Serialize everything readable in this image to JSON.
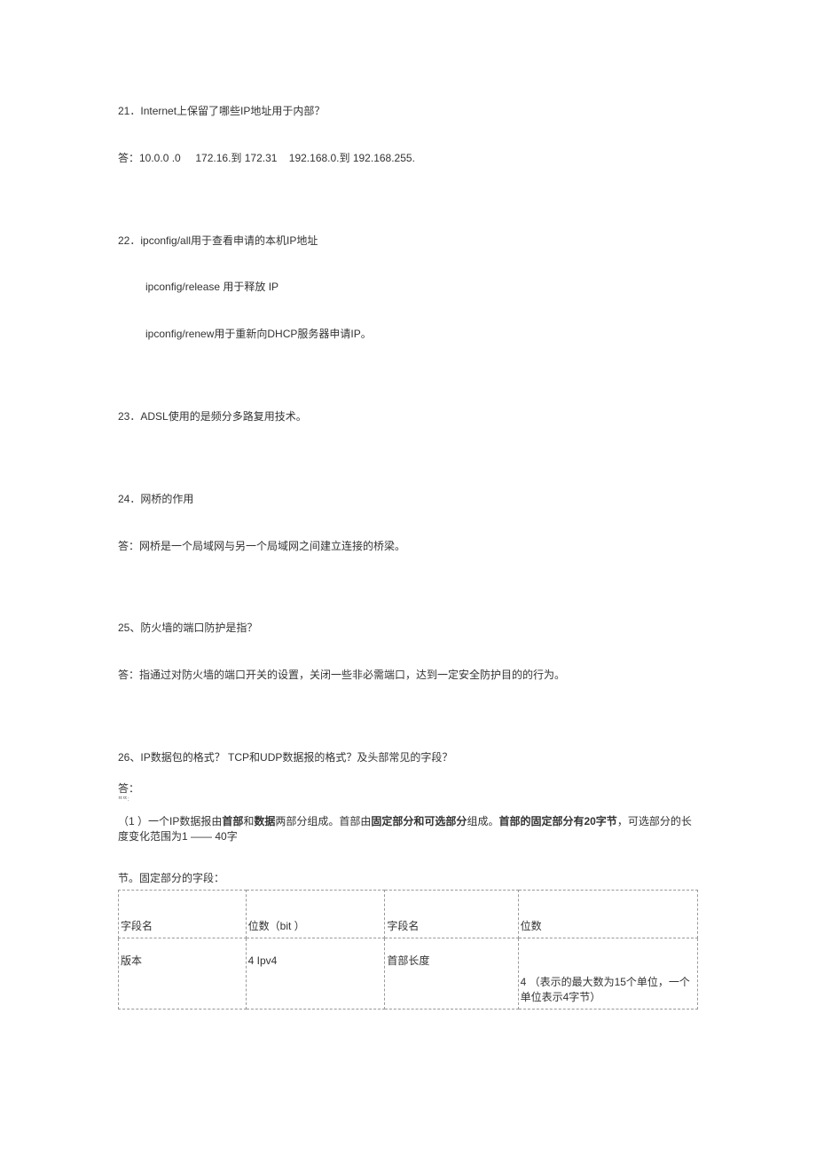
{
  "q21": {
    "num": "21．",
    "text": "Internet上保留了哪些IP地址用于内部？",
    "answer": "答：10.0.0 .0     172.16.到 172.31    192.168.0.到 192.168.255."
  },
  "q22": {
    "num": "22．",
    "line1": "ipconfig/all用于查看申请的本机IP地址",
    "line2": "ipconfig/release 用于释放 IP",
    "line3": "ipconfig/renew用于重新向DHCP服务器申请IP。"
  },
  "q23": {
    "num": "23．",
    "text": "ADSL使用的是频分多路复用技术。"
  },
  "q24": {
    "num": "24．",
    "text": "网桥的作用",
    "answer": "答：网桥是一个局域网与另一个局域网之间建立连接的桥梁。"
  },
  "q25": {
    "num": "25、",
    "text": "防火墙的端口防护是指？",
    "answer": "答：指通过对防火墙的端口开关的设置，关闭一些非必需端口，达到一定安全防护目的的行为。"
  },
  "q26": {
    "num": "26、",
    "text": "IP数据包的格式？ TCP和UDP数据报的格式？及头部常见的字段？",
    "answerPrefix": "答：",
    "p1_a": "（1 ）一个IP数据报由",
    "p1_b": "首部",
    "p1_c": "和",
    "p1_d": "数据",
    "p1_e": "两部分组成。首部由",
    "p1_f": "固定部分和可选部分",
    "p1_g": "组成。",
    "p1_h": "首部的固定部分有20字节",
    "p1_i": "，可选部分的长度变化范围为1 —— 40字",
    "tableIntro": "节。固定部分的字段：",
    "table": {
      "r1c1": "字段名",
      "r1c2": "位数（bit ）",
      "r1c3": "字段名",
      "r1c4": "位数",
      "r2c1": "版本",
      "r2c2": "4 Ipv4",
      "r2c3": "首部长度",
      "r2c4": "4 （表示的最大数为15个单位，一个单位表示4字节）"
    }
  }
}
